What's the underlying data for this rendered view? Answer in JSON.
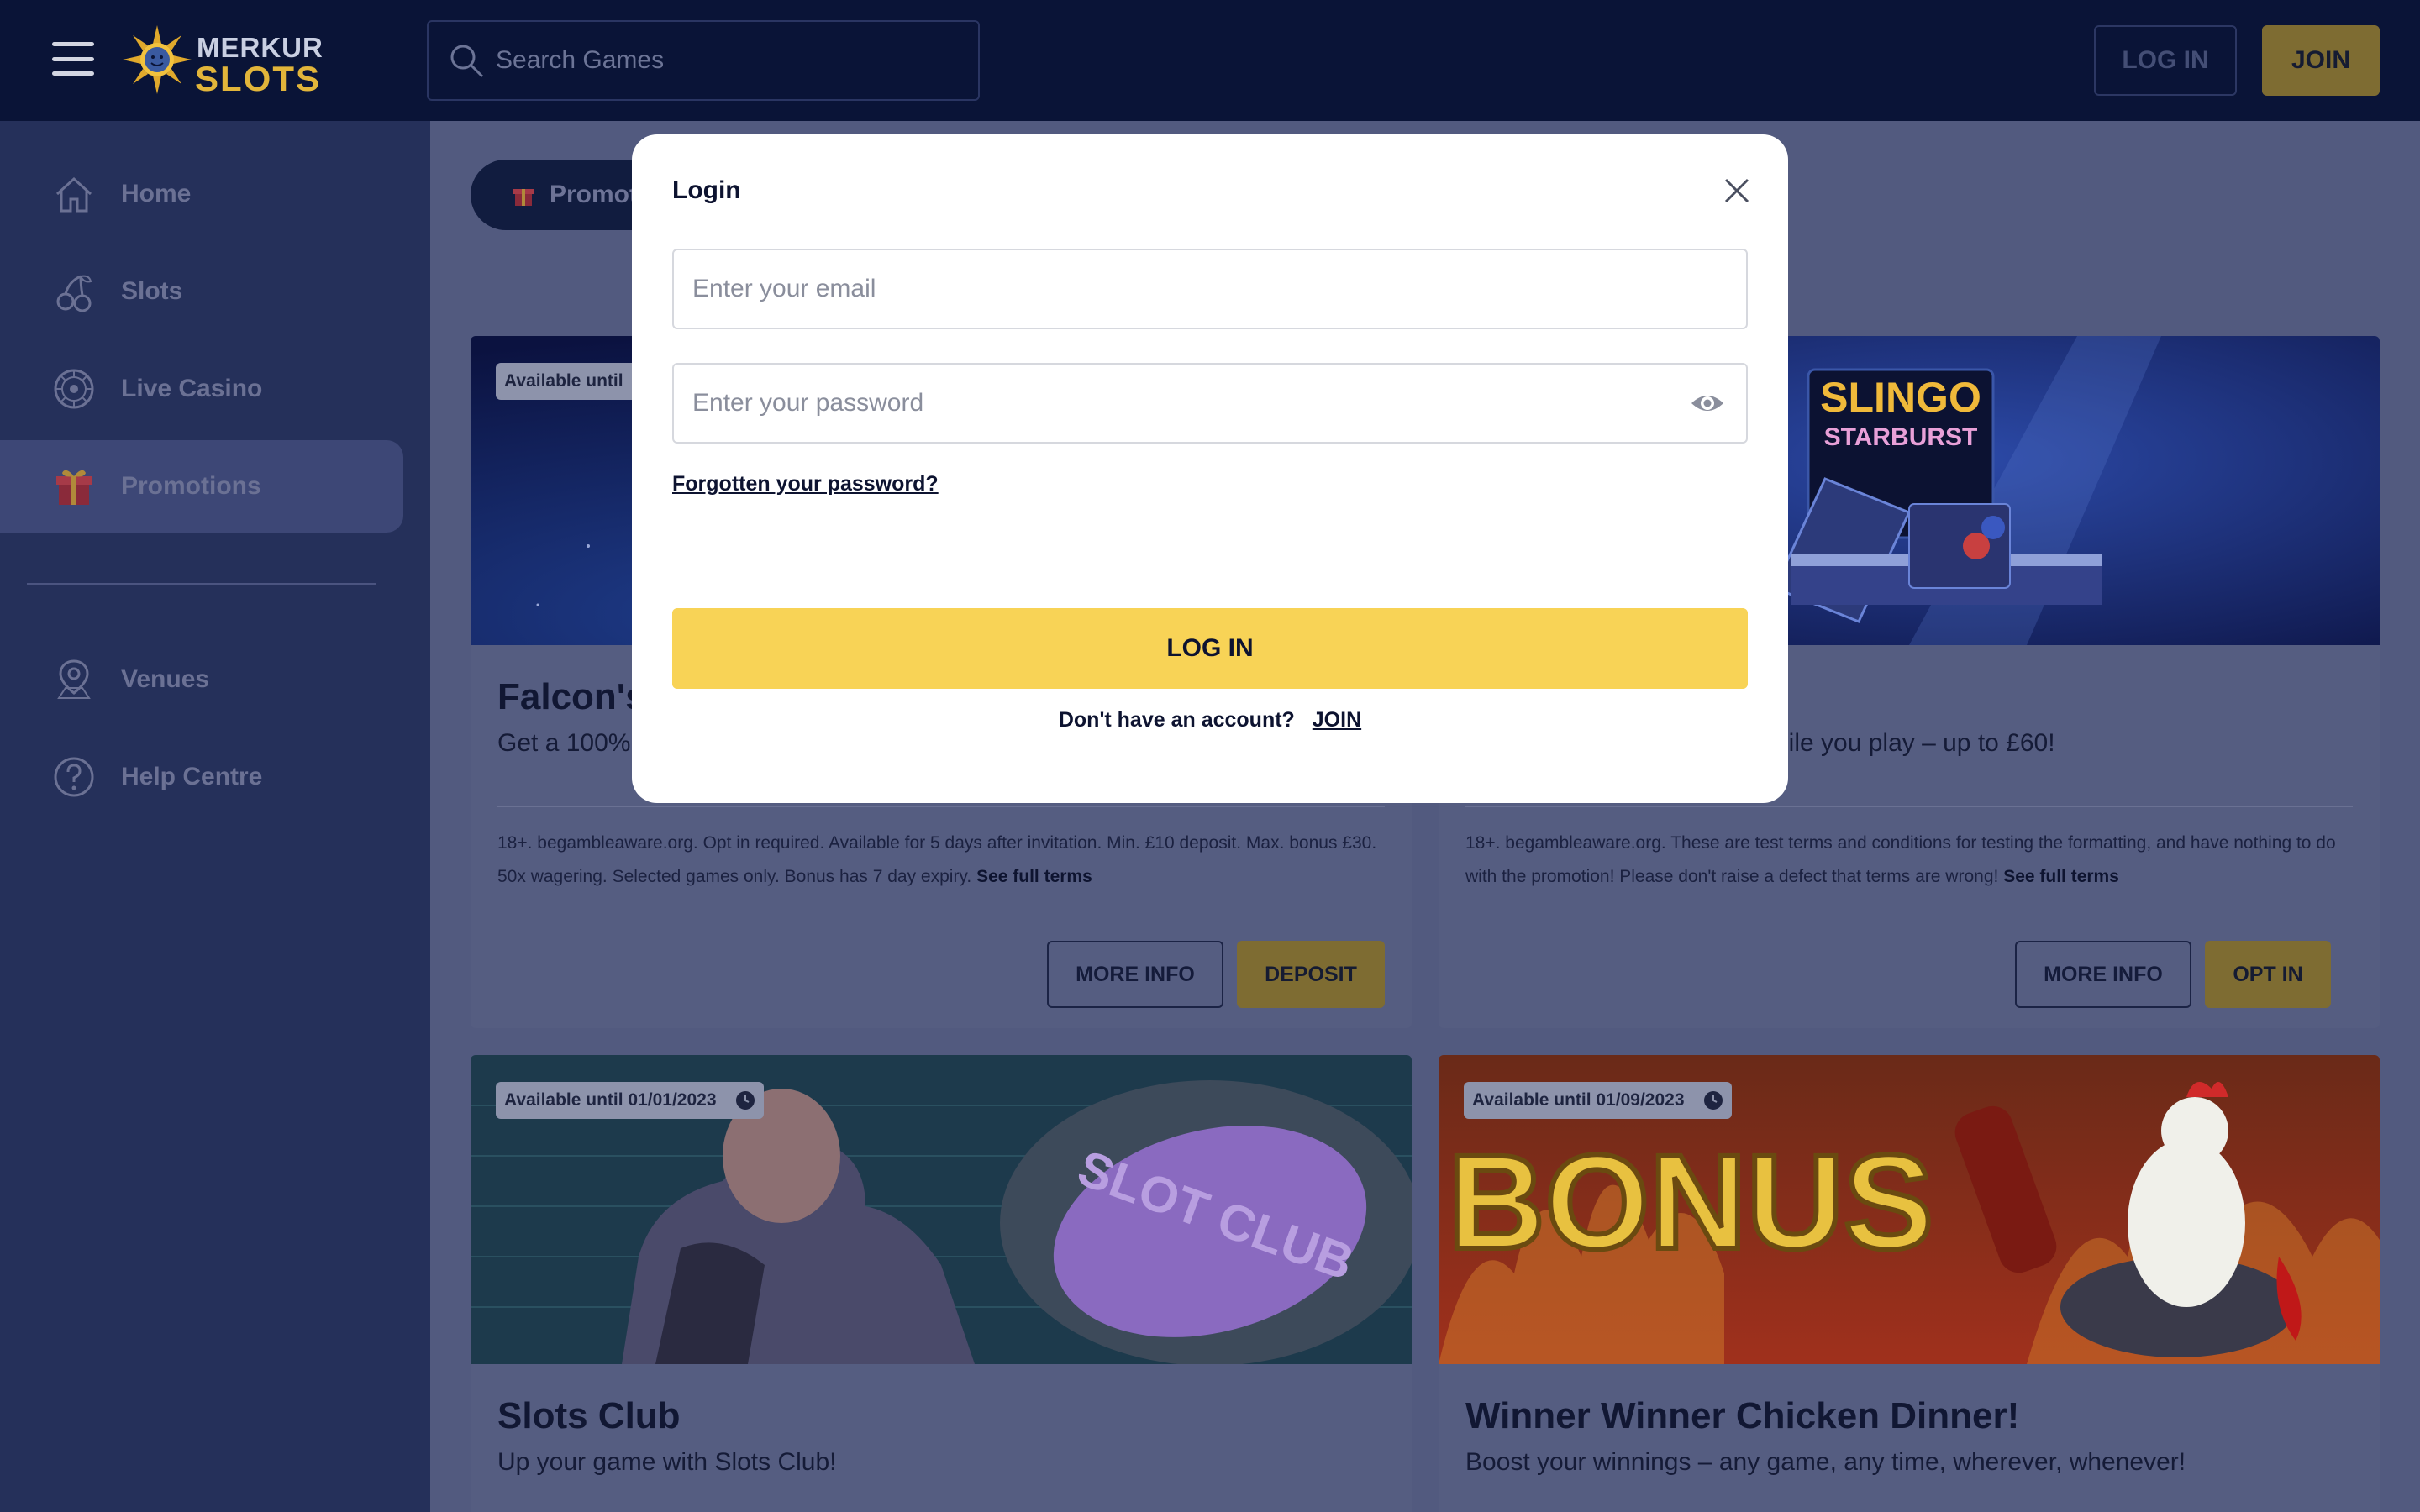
{
  "header": {
    "logo_line1": "MERKUR",
    "logo_line2": "SLOTS",
    "search_placeholder": "Search Games",
    "login_label": "LOG IN",
    "join_label": "JOIN"
  },
  "sidebar": {
    "items": [
      {
        "label": "Home",
        "icon": "home-icon"
      },
      {
        "label": "Slots",
        "icon": "cherries-icon"
      },
      {
        "label": "Live Casino",
        "icon": "roulette-icon"
      },
      {
        "label": "Promotions",
        "icon": "gift-icon",
        "active": true
      },
      {
        "label": "Venues",
        "icon": "location-pin-icon"
      },
      {
        "label": "Help Centre",
        "icon": "help-icon"
      }
    ]
  },
  "main": {
    "tab_label": "Promotions",
    "cards": [
      {
        "badge": "Available until",
        "title": "Falcon's",
        "subtitle": "Get a 100%",
        "terms": "18+. begambleaware.org. Opt in required. Available for 5 days after invitation. Min. £10 deposit. Max. bonus £30. 50x wagering. Selected games only. Bonus has 7 day expiry.",
        "terms_link": "See full terms",
        "more_info": "MORE INFO",
        "action": "DEPOSIT"
      },
      {
        "image_text1": "SLINGO",
        "image_text2": "STARBURST",
        "subtitle": "hile you play – up to £60!",
        "terms": "18+. begambleaware.org. These are test terms and conditions for testing the formatting, and have nothing to do with the promotion! Please don't raise a defect that terms are wrong!",
        "terms_link": "See full terms",
        "more_info": "MORE INFO",
        "action": "OPT IN"
      },
      {
        "badge": "Available until 01/01/2023",
        "image_text": "SLOT CLUB",
        "title": "Slots Club",
        "subtitle": "Up your game with Slots Club!"
      },
      {
        "badge": "Available until 01/09/2023",
        "image_text": "BONUS",
        "title": "Winner Winner Chicken Dinner!",
        "subtitle": "Boost your winnings – any game, any time, wherever, whenever!"
      }
    ]
  },
  "modal": {
    "title": "Login",
    "email_placeholder": "Enter your email",
    "password_placeholder": "Enter your password",
    "forgot": "Forgotten your password?",
    "login_button": "LOG IN",
    "signup_prompt": "Don't have an account?",
    "signup_link": "JOIN"
  },
  "colors": {
    "header_bg": "#0a1437",
    "accent_gold": "#f8d356",
    "overlay_main": "#525a7f"
  }
}
